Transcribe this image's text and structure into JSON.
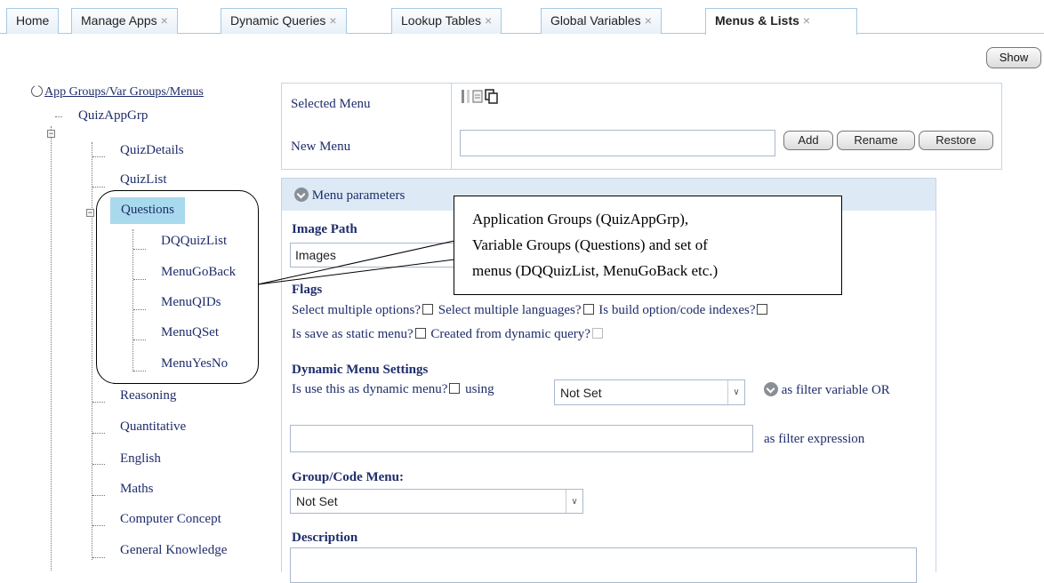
{
  "tabs": [
    {
      "label": "Home",
      "closable": false
    },
    {
      "label": "Manage Apps",
      "closable": true
    },
    {
      "label": "Dynamic Queries",
      "closable": true
    },
    {
      "label": "Lookup Tables",
      "closable": true
    },
    {
      "label": "Global Variables",
      "closable": true
    },
    {
      "label": "Menus & Lists",
      "closable": true,
      "active": true
    }
  ],
  "close_glyph": "×",
  "show_button": "Show",
  "tree": {
    "root": "App Groups/Var Groups/Menus",
    "app_group": "QuizAppGrp",
    "expand_glyph": "−",
    "items": [
      "QuizDetails",
      "QuizList",
      "Questions",
      "DQQuizList",
      "MenuGoBack",
      "MenuQIDs",
      "MenuQSet",
      "MenuYesNo",
      "Reasoning",
      "Quantitative",
      "English",
      "Maths",
      "Computer Concept",
      "General Knowledge"
    ]
  },
  "menu_box": {
    "selected_menu_label": "Selected Menu",
    "new_menu_label": "New Menu",
    "new_menu_value": "",
    "add": "Add",
    "rename": "Rename",
    "restore": "Restore"
  },
  "params": {
    "header": "Menu parameters",
    "image_path_label": "Image Path",
    "image_path_value": "Images",
    "flags_label": "Flags",
    "flag_multi_options": "Select multiple options?",
    "flag_multi_langs": "Select multiple languages?",
    "flag_build_option": "Is build option/code indexes?",
    "flag_static": "Is save as static menu?",
    "flag_dynamic_query": "Created from dynamic query?",
    "dynamic_label": "Dynamic Menu Settings",
    "dynamic_use": "Is use this as dynamic menu?",
    "using": "using",
    "filter_var_value": "Not Set",
    "filter_var_suffix": "as filter variable OR",
    "filter_expr_value": "",
    "filter_expr_suffix": "as filter expression",
    "group_code_label": "Group/Code Menu:",
    "group_code_value": "Not Set",
    "description_label": "Description"
  },
  "callout": {
    "lines": [
      "Application Groups (QuizAppGrp),",
      "Variable Groups (Questions) and set of",
      "menus (DQQuizList, MenuGoBack etc.)"
    ]
  },
  "colors": {
    "accent": "#1f2d6b",
    "tab_border": "#a6c9e2",
    "panel_header": "#dde9f5",
    "selection": "#a9d9ec"
  }
}
